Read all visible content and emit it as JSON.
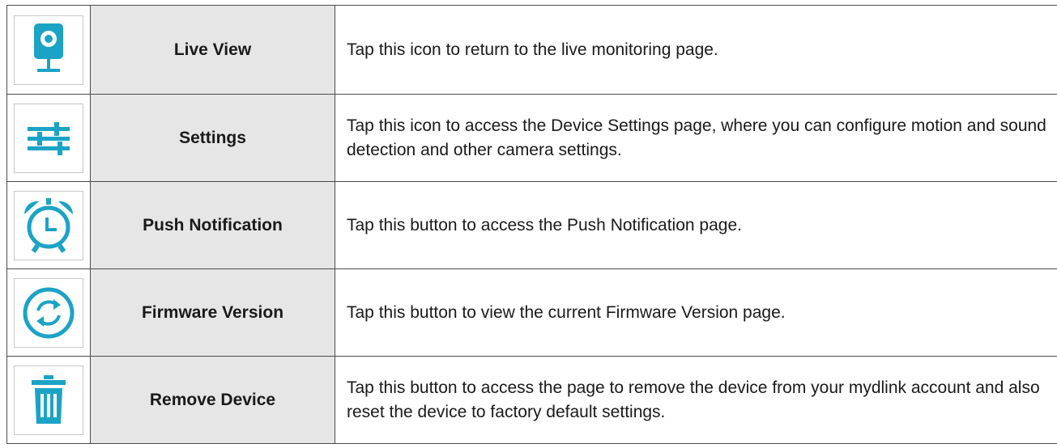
{
  "accent_color": "#1ba3c6",
  "rows": [
    {
      "icon": "camera-icon",
      "name": "Live View",
      "description": "Tap this icon to return to the live monitoring page."
    },
    {
      "icon": "sliders-icon",
      "name": "Settings",
      "description": "Tap this icon to access the Device Settings page, where you can configure motion and sound detection and other camera settings."
    },
    {
      "icon": "alarm-clock-icon",
      "name": "Push Notification",
      "description": "Tap this button to access the Push Notification page."
    },
    {
      "icon": "refresh-icon",
      "name": "Firmware Version",
      "description": "Tap this button to view the current Firmware Version page."
    },
    {
      "icon": "trash-icon",
      "name": "Remove Device",
      "description": "Tap this button to access the page to remove the device from your mydlink account and also reset the device to factory default settings."
    }
  ]
}
